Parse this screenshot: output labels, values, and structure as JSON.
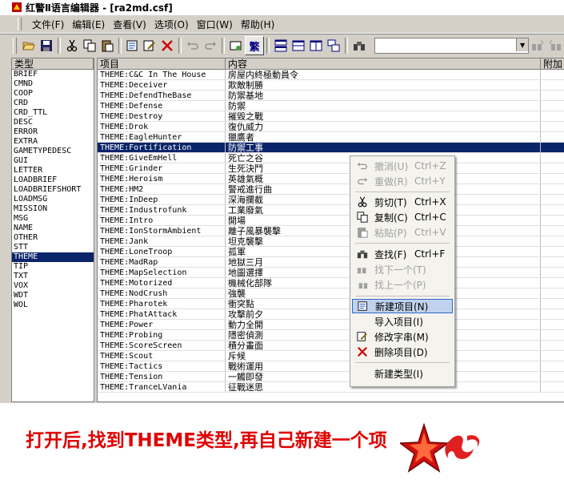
{
  "window": {
    "title": "红警Ⅱ语言编辑器 - [ra2md.csf]"
  },
  "menu": [
    "文件(F)",
    "编辑(E)",
    "查看(V)",
    "选项(O)",
    "窗口(W)",
    "帮助(H)"
  ],
  "types": {
    "header": "类型",
    "items": [
      "BRIEF",
      "CMND",
      "COOP",
      "CRD",
      "CRD_TTL",
      "DESC",
      "ERROR",
      "EXTRA",
      "GAMETYPEDESC",
      "GUI",
      "LETTER",
      "LOADBRIEF",
      "LOADBRIEFSHORT",
      "LOADMSG",
      "MISSION",
      "MSG",
      "NAME",
      "OTHER",
      "STT",
      "THEME",
      "TIP",
      "TXT",
      "VOX",
      "WDT",
      "WOL"
    ],
    "selected": "THEME"
  },
  "grid": {
    "headers": [
      "项目",
      "内容",
      "附加"
    ],
    "rows": [
      [
        "THEME:C&C In The House",
        "房屋内終極動員令"
      ],
      [
        "THEME:Deceiver",
        "欺敵制勝"
      ],
      [
        "THEME:DefendTheBase",
        "防禦基地"
      ],
      [
        "THEME:Defense",
        "防禦"
      ],
      [
        "THEME:Destroy",
        "摧毀之戰"
      ],
      [
        "THEME:Drok",
        "復仇威力"
      ],
      [
        "THEME:EagleHunter",
        "獵鷹者"
      ],
      [
        "THEME:Fortification",
        "防禦工事"
      ],
      [
        "THEME:GiveEmHell",
        "死亡之谷"
      ],
      [
        "THEME:Grinder",
        "生死決鬥"
      ],
      [
        "THEME:Heroism",
        "英雄氣概"
      ],
      [
        "THEME:HM2",
        "警戒進行曲"
      ],
      [
        "THEME:InDeep",
        "深海攔截"
      ],
      [
        "THEME:Industrofunk",
        "工業廢氣"
      ],
      [
        "THEME:Intro",
        "開場"
      ],
      [
        "THEME:IonStormAmbient",
        "離子風暴襲擊"
      ],
      [
        "THEME:Jank",
        "坦克襲擊"
      ],
      [
        "THEME:LoneTroop",
        "孤軍"
      ],
      [
        "THEME:MadRap",
        "地獄三月"
      ],
      [
        "THEME:MapSelection",
        "地圖選擇"
      ],
      [
        "THEME:Motorized",
        "機械化部隊"
      ],
      [
        "THEME:NodCrush",
        "強襲"
      ],
      [
        "THEME:Pharotek",
        "衝突點"
      ],
      [
        "THEME:PhatAttack",
        "攻擊前夕"
      ],
      [
        "THEME:Power",
        "動力全開"
      ],
      [
        "THEME:Probing",
        "隱密偵測"
      ],
      [
        "THEME:ScoreScreen",
        "積分畫面"
      ],
      [
        "THEME:Scout",
        "斥候"
      ],
      [
        "THEME:Tactics",
        "戰術運用"
      ],
      [
        "THEME:Tension",
        "一觸即發"
      ],
      [
        "THEME:TranceLVania",
        "征戰迷思"
      ]
    ],
    "selected_row": "THEME:Fortification"
  },
  "context_menu": {
    "undo": {
      "label": "撤消(U)",
      "shortcut": "Ctrl+Z"
    },
    "redo": {
      "label": "重做(R)",
      "shortcut": "Ctrl+Y"
    },
    "cut": {
      "label": "剪切(T)",
      "shortcut": "Ctrl+X"
    },
    "copy": {
      "label": "复制(C)",
      "shortcut": "Ctrl+C"
    },
    "paste": {
      "label": "粘贴(P)",
      "shortcut": "Ctrl+V"
    },
    "find": {
      "label": "查找(F)",
      "shortcut": "Ctrl+F"
    },
    "find_next": {
      "label": "找下一个(T)"
    },
    "find_prev": {
      "label": "找上一个(P)"
    },
    "new_item": {
      "label": "新建项目(N)"
    },
    "import_item": {
      "label": "导入项目(I)"
    },
    "modify_string": {
      "label": "修改字串(M)"
    },
    "delete_item": {
      "label": "删除项目(D)"
    },
    "new_type": {
      "label": "新建类型(I)"
    }
  },
  "caption": "打开后,找到THEME类型,再自己新建一个项",
  "colors": {
    "selection": "#0a246a",
    "caption": "#e00000",
    "menu_highlight": "#c1d2ee"
  }
}
